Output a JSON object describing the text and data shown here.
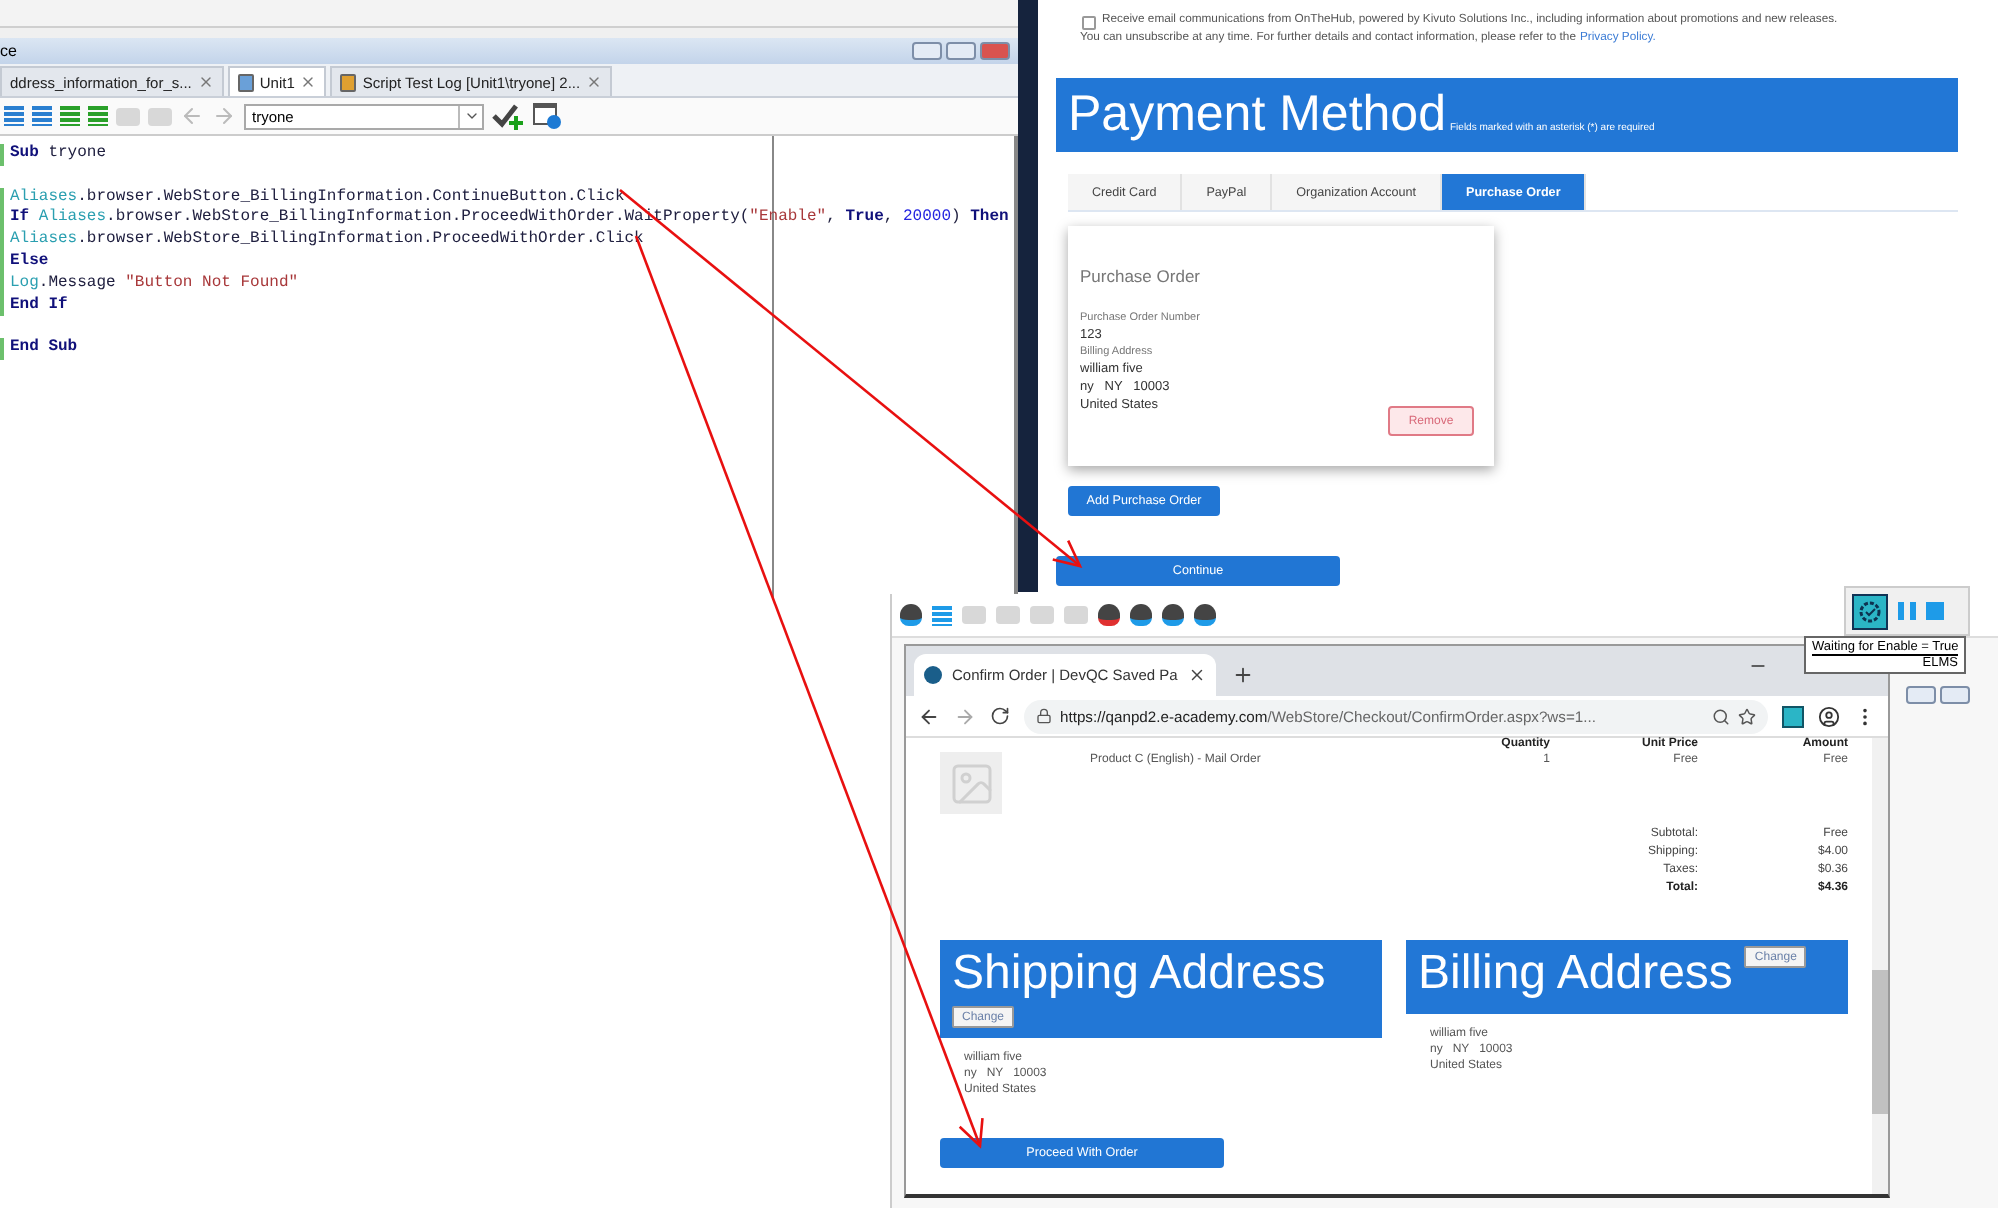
{
  "ide": {
    "title": "ce",
    "tabs": [
      {
        "label": "ddress_information_for_s...",
        "selected": false
      },
      {
        "label": "Unit1",
        "selected": true,
        "kind": "unit"
      },
      {
        "label": "Script Test Log [Unit1\\tryone] 2...",
        "selected": false,
        "kind": "log"
      }
    ],
    "routine": "tryone",
    "code": [
      {
        "blank_before": false,
        "tokens": [
          {
            "kind": "keyword",
            "text": "Sub"
          },
          {
            "kind": "plain",
            "text": " tryone"
          }
        ]
      },
      {
        "blank_before": true,
        "tokens": [
          {
            "kind": "object",
            "text": "Aliases"
          },
          {
            "kind": "plain",
            "text": ".browser.WebStore_BillingInformation.ContinueButton.Click"
          }
        ]
      },
      {
        "blank_before": false,
        "tokens": [
          {
            "kind": "keyword",
            "text": "If "
          },
          {
            "kind": "object",
            "text": "Aliases"
          },
          {
            "kind": "plain",
            "text": ".browser.WebStore_BillingInformation.ProceedWithOrder.WaitProperty("
          },
          {
            "kind": "string",
            "text": "\"Enable\""
          },
          {
            "kind": "plain",
            "text": ", "
          },
          {
            "kind": "keyword",
            "text": "True"
          },
          {
            "kind": "plain",
            "text": ", "
          },
          {
            "kind": "number",
            "text": "20000"
          },
          {
            "kind": "plain",
            "text": ") "
          },
          {
            "kind": "keyword",
            "text": "Then"
          }
        ]
      },
      {
        "blank_before": false,
        "tokens": [
          {
            "kind": "object",
            "text": "Aliases"
          },
          {
            "kind": "plain",
            "text": ".browser.WebStore_BillingInformation.ProceedWithOrder.Click"
          }
        ]
      },
      {
        "blank_before": false,
        "tokens": [
          {
            "kind": "keyword",
            "text": "Else"
          }
        ]
      },
      {
        "blank_before": false,
        "tokens": [
          {
            "kind": "object",
            "text": "Log"
          },
          {
            "kind": "plain",
            "text": ".Message "
          },
          {
            "kind": "string",
            "text": "\"Button Not Found\""
          }
        ]
      },
      {
        "blank_before": false,
        "tokens": [
          {
            "kind": "keyword",
            "text": "End If"
          }
        ]
      },
      {
        "blank_before": true,
        "tokens": [
          {
            "kind": "keyword",
            "text": "End Sub"
          }
        ]
      }
    ]
  },
  "webpage": {
    "consent_checked": false,
    "consent_text": "Receive email communications from OnTheHub, powered by Kivuto Solutions Inc., including information about promotions and new releases.",
    "unsubscribe_text": "You can unsubscribe at any time. For further details and contact information, please refer to the",
    "privacy_link": "Privacy Policy.",
    "heading": "Payment Method",
    "heading_note": "Fields marked with an asterisk (*) are required",
    "tabs": [
      {
        "label": "Credit Card",
        "selected": false
      },
      {
        "label": "PayPal",
        "selected": false
      },
      {
        "label": "Organization Account",
        "selected": false
      },
      {
        "label": "Purchase Order",
        "selected": true
      }
    ],
    "card": {
      "title": "Purchase Order",
      "fields": [
        {
          "label": "Purchase Order Number",
          "lines": [
            "123"
          ]
        },
        {
          "label": "Billing Address",
          "lines": [
            "william five",
            "ny   NY   10003",
            "United States"
          ]
        }
      ],
      "remove": "Remove"
    },
    "add_button": "Add Purchase Order",
    "continue_button": "Continue"
  },
  "runner": {
    "tooltip": [
      "Waiting for Enable = True",
      "ELMS"
    ]
  },
  "browser": {
    "tab_title": "Confirm Order | DevQC Saved Pa",
    "url_host": "https://qanpd2.e-academy.com",
    "url_path": "/WebStore/Checkout/ConfirmOrder.aspx?ws=1...",
    "columns": [
      "Quantity",
      "Unit Price",
      "Amount"
    ],
    "product": {
      "name": "Product C (English) - Mail Order",
      "quantity": "1",
      "unit_price": "Free",
      "amount": "Free"
    },
    "totals": [
      {
        "label": "Subtotal:",
        "value": "Free",
        "bold": false
      },
      {
        "label": "Shipping:",
        "value": "$4.00",
        "bold": false
      },
      {
        "label": "Taxes:",
        "value": "$0.36",
        "bold": false
      },
      {
        "label": "Total:",
        "value": "$4.36",
        "bold": true
      }
    ],
    "addresses": [
      {
        "kind": "shipping",
        "title": "Shipping Address",
        "change": "Change",
        "lines": [
          "william five",
          "ny   NY   10003",
          "United States"
        ]
      },
      {
        "kind": "billing",
        "title": "Billing Address",
        "change": "Change",
        "lines": [
          "william five",
          "ny   NY   10003",
          "United States"
        ]
      }
    ],
    "proceed": "Proceed With Order"
  }
}
